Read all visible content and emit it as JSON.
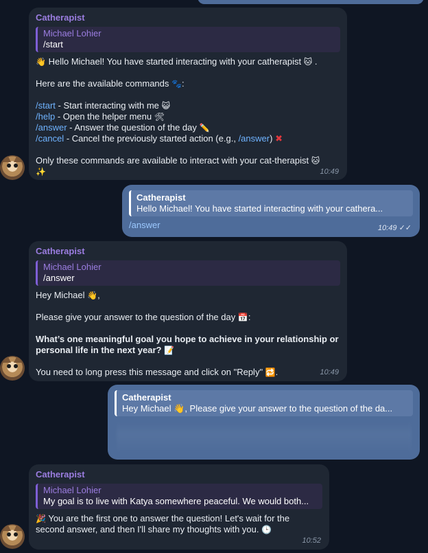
{
  "top_bubble_time": "",
  "messages": [
    {
      "sender": "Catherapist",
      "reply_name": "Michael Lohier",
      "reply_text": "/start",
      "lines": {
        "l1": "Hello Michael! You have started interacting with your catherapist",
        "l2": "Here are the available commands",
        "cmd_start": "/start",
        "cmd_start_desc": " - Start interacting with me",
        "cmd_help": "/help",
        "cmd_help_desc": " - Open the helper menu",
        "cmd_answer": "/answer",
        "cmd_answer_desc": " - Answer the question of the day",
        "cmd_cancel": "/cancel",
        "cmd_cancel_desc_a": " - Cancel the previously started action (e.g., ",
        "cmd_cancel_link": "/answer",
        "cmd_cancel_desc_b": ")",
        "l3": "Only these commands are available to interact with your cat-therapist"
      },
      "time": "10:49"
    },
    {
      "reply_name": "Catherapist",
      "reply_text": "Hello Michael! You have started interacting with your cathera...",
      "text": "/answer",
      "time": "10:49"
    },
    {
      "sender": "Catherapist",
      "reply_name": "Michael Lohier",
      "reply_text": "/answer",
      "lines": {
        "l1": "Hey Michael",
        "l2": "Please give your answer to the question of the day",
        "l3a": "What’s one meaningful goal you hope to achieve in your relationship or",
        "l3b": "personal life in the next year?",
        "l4": "You need to long press this message and click on \"Reply\""
      },
      "time": "10:49"
    },
    {
      "reply_name": "Catherapist",
      "reply_text": "Hey Michael 👋,  Please give your answer to the question of the da..."
    },
    {
      "sender": "Catherapist",
      "reply_name": "Michael Lohier",
      "reply_text": "My goal is to live with Katya somewhere peaceful. We would both...",
      "lines": {
        "l1": "You are the first one to answer the question! Let's wait for the",
        "l2": "second answer, and then I'll share my thoughts with you."
      },
      "time": "10:52"
    }
  ]
}
